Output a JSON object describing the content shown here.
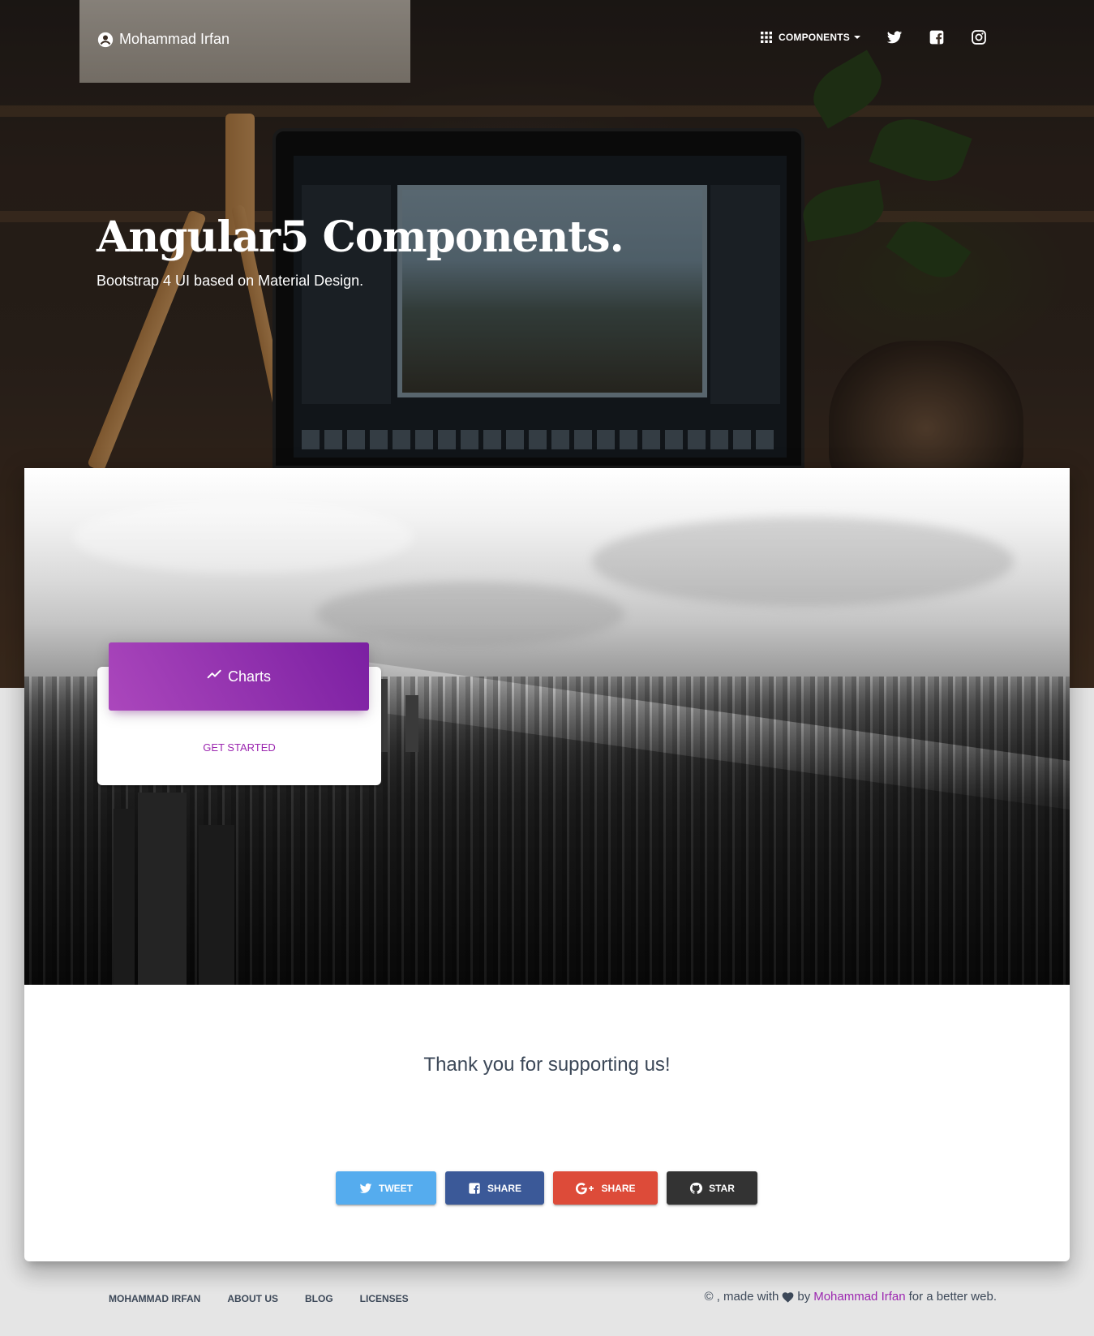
{
  "navbar": {
    "brand": "Mohammad Irfan",
    "components": "COMPONENTS"
  },
  "hero": {
    "title": "Angular5 Components.",
    "subtitle": "Bootstrap 4 UI based on Material Design."
  },
  "card": {
    "header": "Charts",
    "link": "GET STARTED"
  },
  "support": {
    "title": "Thank you for supporting us!",
    "buttons": [
      "TWEET",
      "SHARE",
      "SHARE",
      "STAR"
    ]
  },
  "footer": {
    "links": [
      "MOHAMMAD IRFAN",
      "ABOUT US",
      "BLOG",
      "LICENSES"
    ],
    "copyright_prefix": "© , made with",
    "by": "by",
    "author": "Mohammad Irfan",
    "suffix": "for a better web."
  },
  "colors": {
    "primary": "#9c27b0",
    "twitter": "#55acee",
    "facebook": "#3b5998",
    "google": "#dd4b39",
    "github": "#333333"
  }
}
